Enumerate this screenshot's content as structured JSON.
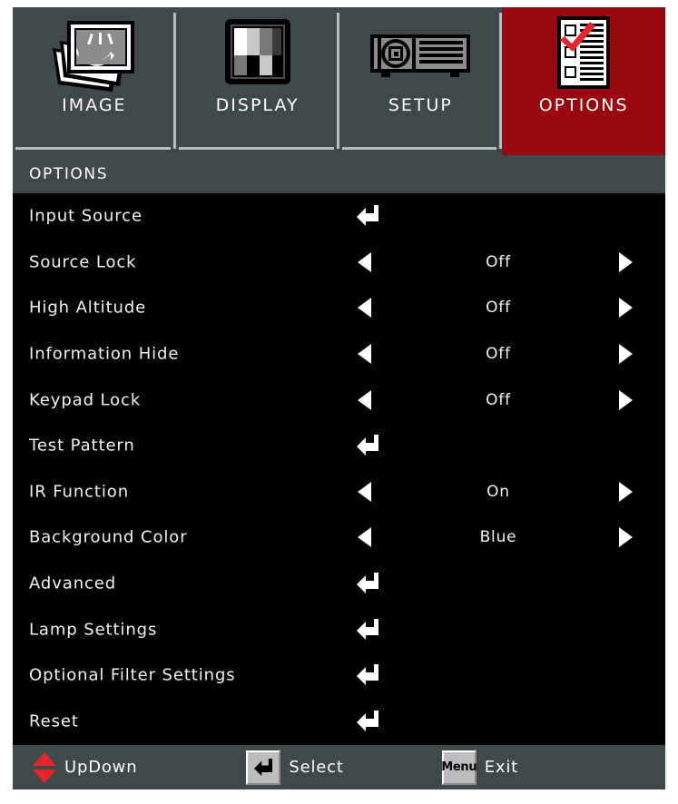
{
  "tabs": [
    {
      "label": "IMAGE",
      "icon": "image-picture-icon",
      "active": false
    },
    {
      "label": "DISPLAY",
      "icon": "test-pattern-icon",
      "active": false
    },
    {
      "label": "SETUP",
      "icon": "projector-icon",
      "active": false
    },
    {
      "label": "OPTIONS",
      "icon": "checklist-icon",
      "active": true
    }
  ],
  "menu": {
    "title": "OPTIONS",
    "rows": [
      {
        "label": "Input Source",
        "type": "submenu",
        "value": ""
      },
      {
        "label": "Source Lock",
        "type": "option",
        "value": "Off"
      },
      {
        "label": "High Altitude",
        "type": "option",
        "value": "Off"
      },
      {
        "label": "Information Hide",
        "type": "option",
        "value": "Off"
      },
      {
        "label": "Keypad Lock",
        "type": "option",
        "value": "Off"
      },
      {
        "label": "Test Pattern",
        "type": "submenu",
        "value": ""
      },
      {
        "label": "IR Function",
        "type": "option",
        "value": "On"
      },
      {
        "label": "Background Color",
        "type": "option",
        "value": "Blue"
      },
      {
        "label": "Advanced",
        "type": "submenu",
        "value": ""
      },
      {
        "label": "Lamp Settings",
        "type": "submenu",
        "value": ""
      },
      {
        "label": "Optional Filter Settings",
        "type": "submenu",
        "value": ""
      },
      {
        "label": "Reset",
        "type": "submenu",
        "value": ""
      }
    ]
  },
  "footer": {
    "updown_label": "UpDown",
    "select_key": "",
    "select_label": "Select",
    "exit_key": "Menu",
    "exit_label": "Exit"
  },
  "colors": {
    "active_tab": "#990711",
    "chrome": "#3f484b",
    "menu_background": "#000000",
    "text": "#ffffff",
    "accent_red": "#e8262a"
  }
}
